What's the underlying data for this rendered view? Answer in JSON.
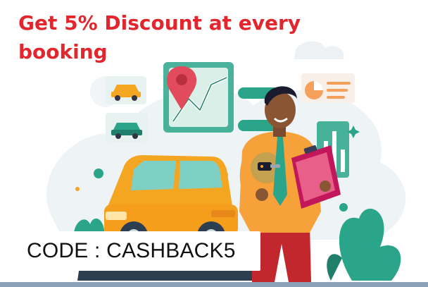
{
  "banner": {
    "headline": "Get 5% Discount at every booking",
    "code_label": "CODE : CASHBACK5"
  },
  "colors": {
    "headline_red": "#e3262d",
    "car_orange": "#f4a623",
    "teal": "#2aa58a",
    "shirt_orange": "#f6a13a"
  },
  "icons": [
    "location-pin-icon",
    "car-icon",
    "pie-chart-icon",
    "bar-chart-icon",
    "car-key-icon",
    "clipboard-icon"
  ]
}
